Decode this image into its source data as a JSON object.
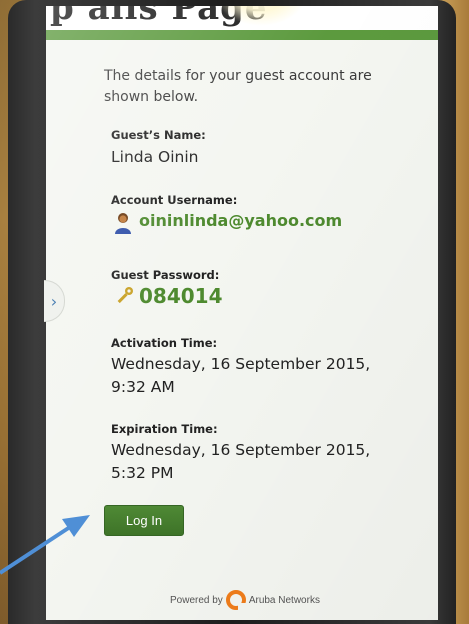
{
  "header": {
    "partial_heading": "p        ails Page"
  },
  "intro": "The details for your guest account are shown below.",
  "fields": {
    "name_label": "Guest’s Name:",
    "name_value": "Linda Oinin",
    "username_label": "Account Username:",
    "username_value": "oininlinda@yahoo.com",
    "password_label": "Guest Password:",
    "password_value": "084014",
    "activation_label": "Activation Time:",
    "activation_value": "Wednesday, 16 September 2015, 9:32 AM",
    "expiration_label": "Expiration Time:",
    "expiration_value": "Wednesday, 16 September 2015, 5:32 PM"
  },
  "actions": {
    "login_label": "Log In"
  },
  "footer": {
    "powered_by": "Powered by",
    "brand": "Aruba Networks"
  },
  "side_tab": {
    "glyph": "›"
  },
  "colors": {
    "accent_green": "#4e8a2f",
    "bar_green": "#5c9a3e",
    "button_green": "#3e7428",
    "aruba_orange": "#f07d1a",
    "arrow_blue": "#4f8fd6"
  },
  "icons": [
    "user-icon",
    "key-icon",
    "chevron-right-icon",
    "aruba-logo-icon",
    "arrow-icon"
  ]
}
